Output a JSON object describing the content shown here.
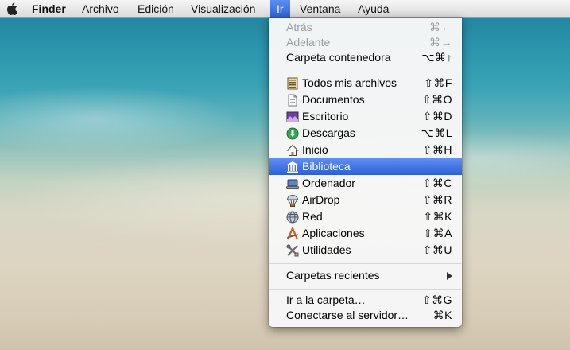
{
  "menubar": {
    "app": "Finder",
    "items": [
      "Archivo",
      "Edición",
      "Visualización",
      "Ir",
      "Ventana",
      "Ayuda"
    ]
  },
  "go_menu": {
    "nav": [
      {
        "label": "Atrás",
        "shortcut": "⌘←"
      },
      {
        "label": "Adelante",
        "shortcut": "⌘→"
      },
      {
        "label": "Carpeta contenedora",
        "shortcut": "⌥⌘↑"
      }
    ],
    "places": [
      {
        "label": "Todos mis archivos",
        "shortcut": "⇧⌘F",
        "icon": "all-files-icon"
      },
      {
        "label": "Documentos",
        "shortcut": "⇧⌘O",
        "icon": "documents-icon"
      },
      {
        "label": "Escritorio",
        "shortcut": "⇧⌘D",
        "icon": "desktop-icon"
      },
      {
        "label": "Descargas",
        "shortcut": "⌥⌘L",
        "icon": "downloads-icon"
      },
      {
        "label": "Inicio",
        "shortcut": "⇧⌘H",
        "icon": "home-icon"
      },
      {
        "label": "Biblioteca",
        "shortcut": "",
        "icon": "library-icon"
      },
      {
        "label": "Ordenador",
        "shortcut": "⇧⌘C",
        "icon": "computer-icon"
      },
      {
        "label": "AirDrop",
        "shortcut": "⇧⌘R",
        "icon": "airdrop-icon"
      },
      {
        "label": "Red",
        "shortcut": "⇧⌘K",
        "icon": "network-icon"
      },
      {
        "label": "Aplicaciones",
        "shortcut": "⇧⌘A",
        "icon": "applications-icon"
      },
      {
        "label": "Utilidades",
        "shortcut": "⇧⌘U",
        "icon": "utilities-icon"
      }
    ],
    "recent": {
      "label": "Carpetas recientes"
    },
    "goto": [
      {
        "label": "Ir a la carpeta…",
        "shortcut": "⇧⌘G"
      },
      {
        "label": "Conectarse al servidor…",
        "shortcut": "⌘K"
      }
    ],
    "highlighted": "Biblioteca",
    "colors": {
      "highlight": "#2c5fd6",
      "menu_bg": "#f6f6f6",
      "disabled_text": "#9c9c9c"
    }
  }
}
